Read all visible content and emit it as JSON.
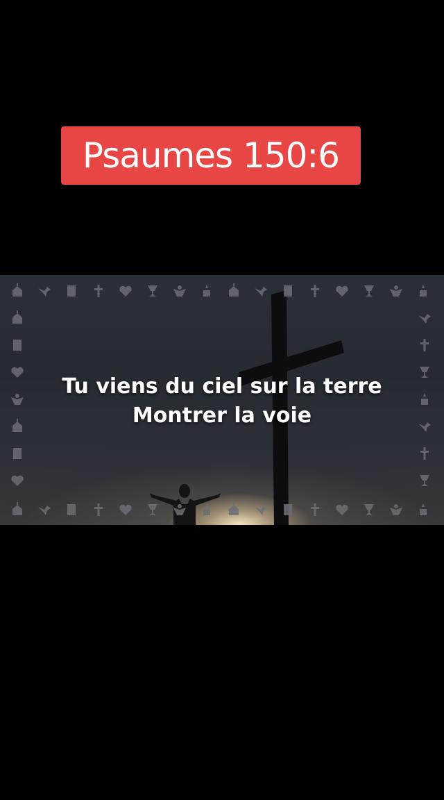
{
  "title_badge": {
    "text": "Psaumes 150:6",
    "color": "#e84545"
  },
  "lyrics": {
    "line1": "Tu viens du ciel sur la terre",
    "line2": "Montrer la voie"
  },
  "scene": {
    "description_icons": [
      "church-icon",
      "dove-icon",
      "bible-icon",
      "cross-icon",
      "heart-icon",
      "chalice-icon",
      "angel-icon",
      "candle-icon"
    ]
  }
}
